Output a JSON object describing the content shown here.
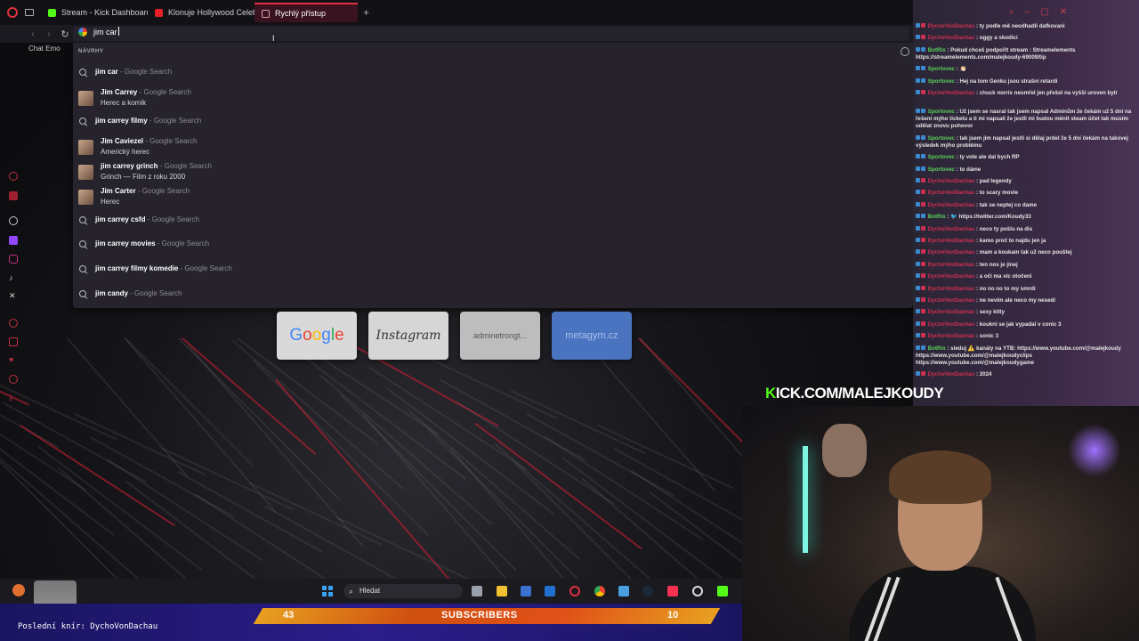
{
  "tabs": [
    {
      "label": "Stream - Kick Dashboard",
      "color": "#53fc18"
    },
    {
      "label": "Klonuje Hollywood Celeb",
      "color": "#e8202a"
    },
    {
      "label": "Rychlý přístup",
      "color": "#e0303f",
      "active": true
    }
  ],
  "address_bar": {
    "value": "jim car"
  },
  "bookmarks_label": "Chat Emo",
  "suggestions": {
    "header": "NÁVRHY",
    "items": [
      {
        "bold": "jim car",
        "rest": "",
        "source": "- Google Search",
        "subtitle": ""
      },
      {
        "bold": "Jim Car",
        "rest": "rey",
        "source": "- Google Search",
        "subtitle": "Herec a komik",
        "thumb": true
      },
      {
        "bold": "jim car",
        "rest": "rey filmy",
        "source": "- Google Search",
        "subtitle": ""
      },
      {
        "bold": "Jim Ca",
        "rest": "viezel",
        "source": "- Google Search",
        "subtitle": "Americký herec",
        "thumb": true
      },
      {
        "bold": "jim car",
        "rest": "rey grinch",
        "source": "- Google Search",
        "subtitle": "Grinch — Film z roku 2000",
        "thumb": true
      },
      {
        "bold": "Jim Car",
        "rest": "ter",
        "source": "- Google Search",
        "subtitle": "Herec",
        "thumb": true
      },
      {
        "bold": "jim car",
        "rest": "rey csfd",
        "source": "- Google Search",
        "subtitle": ""
      },
      {
        "bold": "jim car",
        "rest": "rey movies",
        "source": "- Google Search",
        "subtitle": ""
      },
      {
        "bold": "jim car",
        "rest": "rey filmy komedie",
        "source": "- Google Search",
        "subtitle": ""
      },
      {
        "bold": "jim ca",
        "rest": "ndy",
        "source": "- Google Search",
        "subtitle": ""
      }
    ]
  },
  "speed_dial": [
    "Google",
    "Instagram",
    "adminetrongt...",
    "metagym.cz"
  ],
  "chat": [
    {
      "user": "DychoVonDachau",
      "type": "dycho",
      "msg": ": ty podle mě neodhadli dafkovani"
    },
    {
      "user": "DychoVonDachau",
      "type": "dycho",
      "msg": ": oggy a skodici"
    },
    {
      "user": "BotRix",
      "type": "bot",
      "msg": ": Pokud chceš podpořit stream : Streamelements https://streamelements.com/malejkoudy-69009/tip"
    },
    {
      "user": "Sportovec",
      "type": "sport",
      "msg": ": 👏🏻"
    },
    {
      "user": "Sportovec",
      "type": "sport",
      "msg": ": Hej na tom Genku jsou strašní retardi"
    },
    {
      "user": "DychoVonDachau",
      "type": "dycho",
      "msg": ": chuck norris neumřel jen přešel na vyšší uroven bytí"
    },
    {
      "user": "Sportovec",
      "type": "sport",
      "msg": ": Už jsem se nasral tak jsem napsal Adminům že čekám už 5 dní na řešení mýho ticketu a ti mi napsali že jestli mi budou měnit steam účet tak musím udělat znovu pohovor"
    },
    {
      "user": "Sportovec",
      "type": "sport",
      "msg": ": tak jsem jim napsal jestli si dělaj prdel že 5 dní čekám na takovej výsledek mýho problému"
    },
    {
      "user": "Sportovec",
      "type": "sport",
      "msg": ": ty vole ale dal bych RP"
    },
    {
      "user": "Sportovec",
      "type": "sport",
      "msg": ": to dáme"
    },
    {
      "user": "DychoVonDachau",
      "type": "dycho",
      "msg": ": pad legendy"
    },
    {
      "user": "DychoVonDachau",
      "type": "dycho",
      "msg": ": to scary movie"
    },
    {
      "user": "DychoVonDachau",
      "type": "dycho",
      "msg": ": tak se neptej co dame"
    },
    {
      "user": "BotRix",
      "type": "bot",
      "msg": ": 🐦 https://twitter.com/Koudy33"
    },
    {
      "user": "DychoVonDachau",
      "type": "dycho",
      "msg": ": neco ty pošlu na dis"
    },
    {
      "user": "DychoVonDachau",
      "type": "dycho",
      "msg": ": kamo proč to najdu jen ja"
    },
    {
      "user": "DychoVonDachau",
      "type": "dycho",
      "msg": ": mam a koukam tak už neco pouštej"
    },
    {
      "user": "DychoVonDachau",
      "type": "dycho",
      "msg": ": ten nos je jinej"
    },
    {
      "user": "DychoVonDachau",
      "type": "dycho",
      "msg": ": a oči ma víc otočeni"
    },
    {
      "user": "DychoVonDachau",
      "type": "dycho",
      "msg": ": no no no to my smrdi"
    },
    {
      "user": "DychoVonDachau",
      "type": "dycho",
      "msg": ": ne nevim ale neco my nesedí"
    },
    {
      "user": "DychoVonDachau",
      "type": "dycho",
      "msg": ": sexy kitty"
    },
    {
      "user": "DychoVonDachau",
      "type": "dycho",
      "msg": ": koukni se jak vypadal v conic 3"
    },
    {
      "user": "DychoVonDachau",
      "type": "dycho",
      "msg": ": sonic 3"
    },
    {
      "user": "BotRix",
      "type": "bot",
      "msg": ": sleduj ⚠️ kanály na YTB: https://www.youtube.com/@malejkoudy https://www.youtube.com/@malejkoudyclips https://www.youtube.com/@malejkoudygame"
    },
    {
      "user": "DychoVonDachau",
      "type": "dycho",
      "msg": ": 2024"
    }
  ],
  "kick_logo": {
    "k": "K",
    "rest": "ICK.COM/MALEJKOUDY"
  },
  "taskbar": {
    "search": "Hledat"
  },
  "overlay": {
    "last_sub": "Poslední knír: DychoVonDachau",
    "left_count": "43",
    "label": "SUBSCRIBERS",
    "right_count": "10"
  }
}
